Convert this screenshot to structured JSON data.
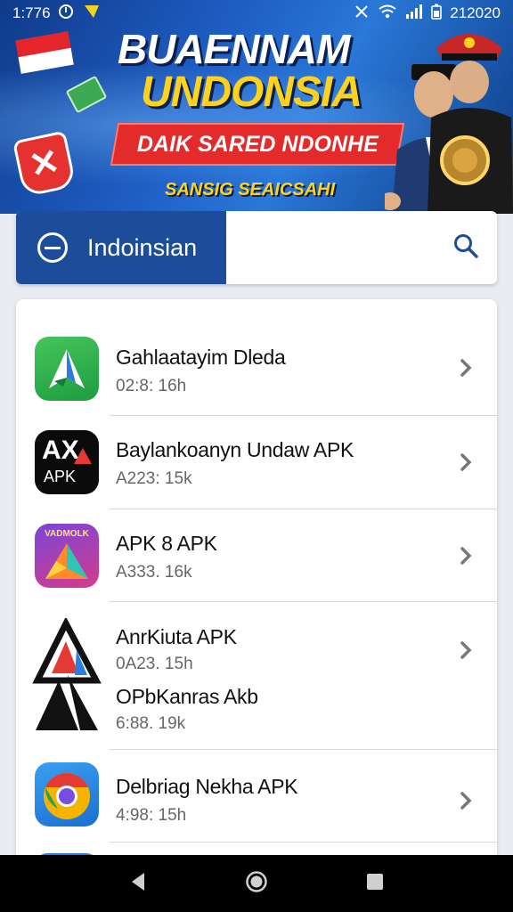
{
  "status_bar": {
    "time": "1:776",
    "right_text": "212020"
  },
  "banner": {
    "title_line1": "BUAENNAM",
    "title_line2": "UNDONSIA",
    "ribbon": "DAIK SARED NDONHE",
    "subline": "SANSIG SEAICSAHI"
  },
  "search": {
    "label": "Indoinsian"
  },
  "apps": [
    {
      "name": "Gahlaatayim Dleda",
      "meta": "02:8: 16h"
    },
    {
      "name": "Baylankoanyn Undaw APK",
      "meta": "A223: 15k"
    },
    {
      "name": "APK 8 APK",
      "meta": "A333. 16k"
    },
    {
      "name": "AnrKiuta APK",
      "meta": "0A23. 15h",
      "name2": "OPbKanras Akb",
      "meta2": "6:88. 19k"
    },
    {
      "name": "Delbriag Nekha APK",
      "meta": "4:98: 15h"
    }
  ],
  "icon_labels": {
    "ax": "AX",
    "apk": "APK",
    "vadmolk": "VADMOLK"
  },
  "colors": {
    "accent": "#1d4d9a",
    "banner_red": "#e42b2b",
    "banner_yellow": "#ffd21d"
  }
}
